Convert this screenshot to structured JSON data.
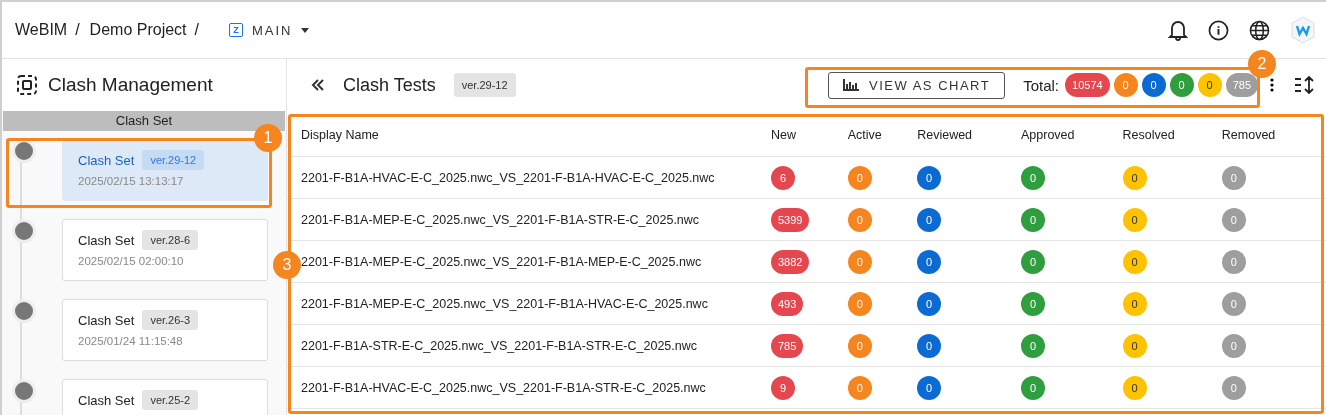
{
  "breadcrumb": [
    {
      "text": "WeBIM",
      "kind": "link"
    },
    {
      "text": "/",
      "kind": "separator"
    },
    {
      "text": "Demo Project",
      "kind": "link"
    },
    {
      "text": "/",
      "kind": "separator"
    }
  ],
  "branch": {
    "badge": "Z",
    "label": "MAIN"
  },
  "sidebar": {
    "title": "Clash Management",
    "section": "Clash Set",
    "items": [
      {
        "name": "Clash Set",
        "version": "ver.29-12",
        "date": "2025/02/15 13:13:17",
        "selected": true
      },
      {
        "name": "Clash Set",
        "version": "ver.28-6",
        "date": "2025/02/15 02:00:10",
        "selected": false
      },
      {
        "name": "Clash Set",
        "version": "ver.26-3",
        "date": "2025/01/24 11:15:48",
        "selected": false
      },
      {
        "name": "Clash Set",
        "version": "ver.25-2",
        "selected": false
      }
    ]
  },
  "toolbar": {
    "title": "Clash Tests",
    "version": "ver.29-12",
    "chart_button": "VIEW AS CHART",
    "total_label": "Total:",
    "totals": [
      "10574",
      "0",
      "0",
      "0",
      "0",
      "785"
    ]
  },
  "table": {
    "columns": [
      {
        "label": "Display Name",
        "kind": "name"
      },
      {
        "label": "New",
        "kind": "new"
      },
      {
        "label": "Active",
        "kind": "active"
      },
      {
        "label": "Reviewed",
        "kind": "reviewed"
      },
      {
        "label": "Approved",
        "kind": "approved"
      },
      {
        "label": "Resolved",
        "kind": "resolved"
      },
      {
        "label": "Removed",
        "kind": "removed"
      }
    ],
    "rows": [
      [
        "2201-F-B1A-HVAC-E-C_2025.nwc_VS_2201-F-B1A-HVAC-E-C_2025.nwc",
        "6",
        "0",
        "0",
        "0",
        "0",
        "0"
      ],
      [
        "2201-F-B1A-MEP-E-C_2025.nwc_VS_2201-F-B1A-STR-E-C_2025.nwc",
        "5399",
        "0",
        "0",
        "0",
        "0",
        "0"
      ],
      [
        "2201-F-B1A-MEP-E-C_2025.nwc_VS_2201-F-B1A-MEP-E-C_2025.nwc",
        "3882",
        "0",
        "0",
        "0",
        "0",
        "0"
      ],
      [
        "2201-F-B1A-MEP-E-C_2025.nwc_VS_2201-F-B1A-HVAC-E-C_2025.nwc",
        "493",
        "0",
        "0",
        "0",
        "0",
        "0"
      ],
      [
        "2201-F-B1A-STR-E-C_2025.nwc_VS_2201-F-B1A-STR-E-C_2025.nwc",
        "785",
        "0",
        "0",
        "0",
        "0",
        "0"
      ],
      [
        "2201-F-B1A-HVAC-E-C_2025.nwc_VS_2201-F-B1A-STR-E-C_2025.nwc",
        "9",
        "0",
        "0",
        "0",
        "0",
        "0"
      ]
    ]
  },
  "callouts": [
    "1",
    "2",
    "3"
  ]
}
